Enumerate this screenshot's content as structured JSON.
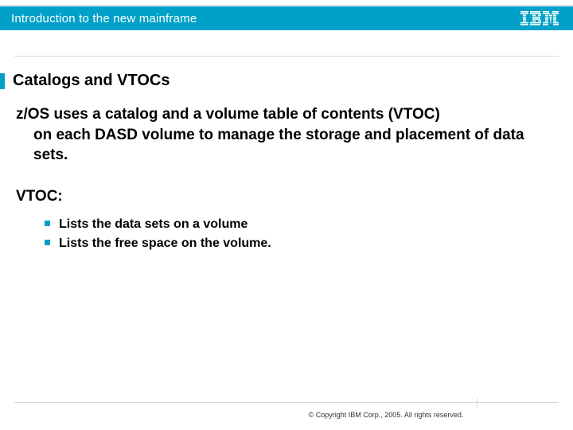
{
  "header": {
    "title": "Introduction to the new mainframe",
    "logo_label": "IBM"
  },
  "slide": {
    "title": "Catalogs and VTOCs",
    "body_line1": "z/OS uses a catalog and a volume table of contents (VTOC)",
    "body_cont": "on each DASD volume to manage the storage and placement of data sets.",
    "section_label": "VTOC:",
    "bullets": [
      "Lists the data sets on a volume",
      "Lists the free space on the volume."
    ]
  },
  "footer": {
    "copyright": "© Copyright IBM Corp., 2005. All rights reserved."
  }
}
